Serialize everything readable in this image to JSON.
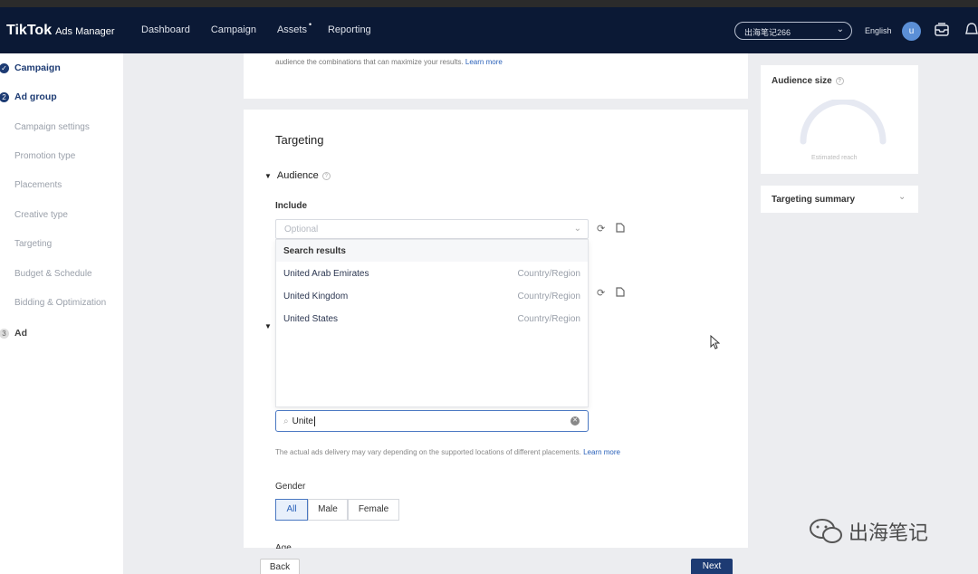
{
  "header": {
    "brand": "TikTok",
    "product": "Ads Manager",
    "nav": [
      "Dashboard",
      "Campaign",
      "Assets",
      "Reporting"
    ],
    "assets_dot": "•",
    "account": "出海笔记266",
    "language": "English",
    "avatar_initial": "u"
  },
  "sidebar": {
    "steps": [
      {
        "num": "✓",
        "label": "Campaign"
      },
      {
        "num": "2",
        "label": "Ad group"
      },
      {
        "num": "3",
        "label": "Ad"
      }
    ],
    "subs": [
      "Campaign settings",
      "Promotion type",
      "Placements",
      "Creative type",
      "Targeting",
      "Budget & Schedule",
      "Bidding & Optimization"
    ]
  },
  "top_card": {
    "text": "audience the combinations that can maximize your results.",
    "link": "Learn more"
  },
  "targeting": {
    "title": "Targeting",
    "section": "Audience",
    "include_label": "Include",
    "select_placeholder": "Optional",
    "dropdown_header": "Search results",
    "results": [
      {
        "name": "United Arab Emirates",
        "type": "Country/Region"
      },
      {
        "name": "United Kingdom",
        "type": "Country/Region"
      },
      {
        "name": "United States",
        "type": "Country/Region"
      }
    ],
    "search_value": "Unite",
    "note": "The actual ads delivery may vary depending on the supported locations of different placements.",
    "note_link": "Learn more",
    "gender_label": "Gender",
    "gender_options": [
      "All",
      "Male",
      "Female"
    ],
    "age_label": "Age"
  },
  "footer": {
    "back": "Back",
    "next": "Next"
  },
  "audience_panel": {
    "title": "Audience size",
    "estimated": "Estimated reach"
  },
  "summary_panel": {
    "title": "Targeting summary"
  },
  "watermark": "出海笔记",
  "colors": {
    "navy": "#0b1935",
    "primary": "#1d3b73",
    "link": "#2a61b9"
  }
}
